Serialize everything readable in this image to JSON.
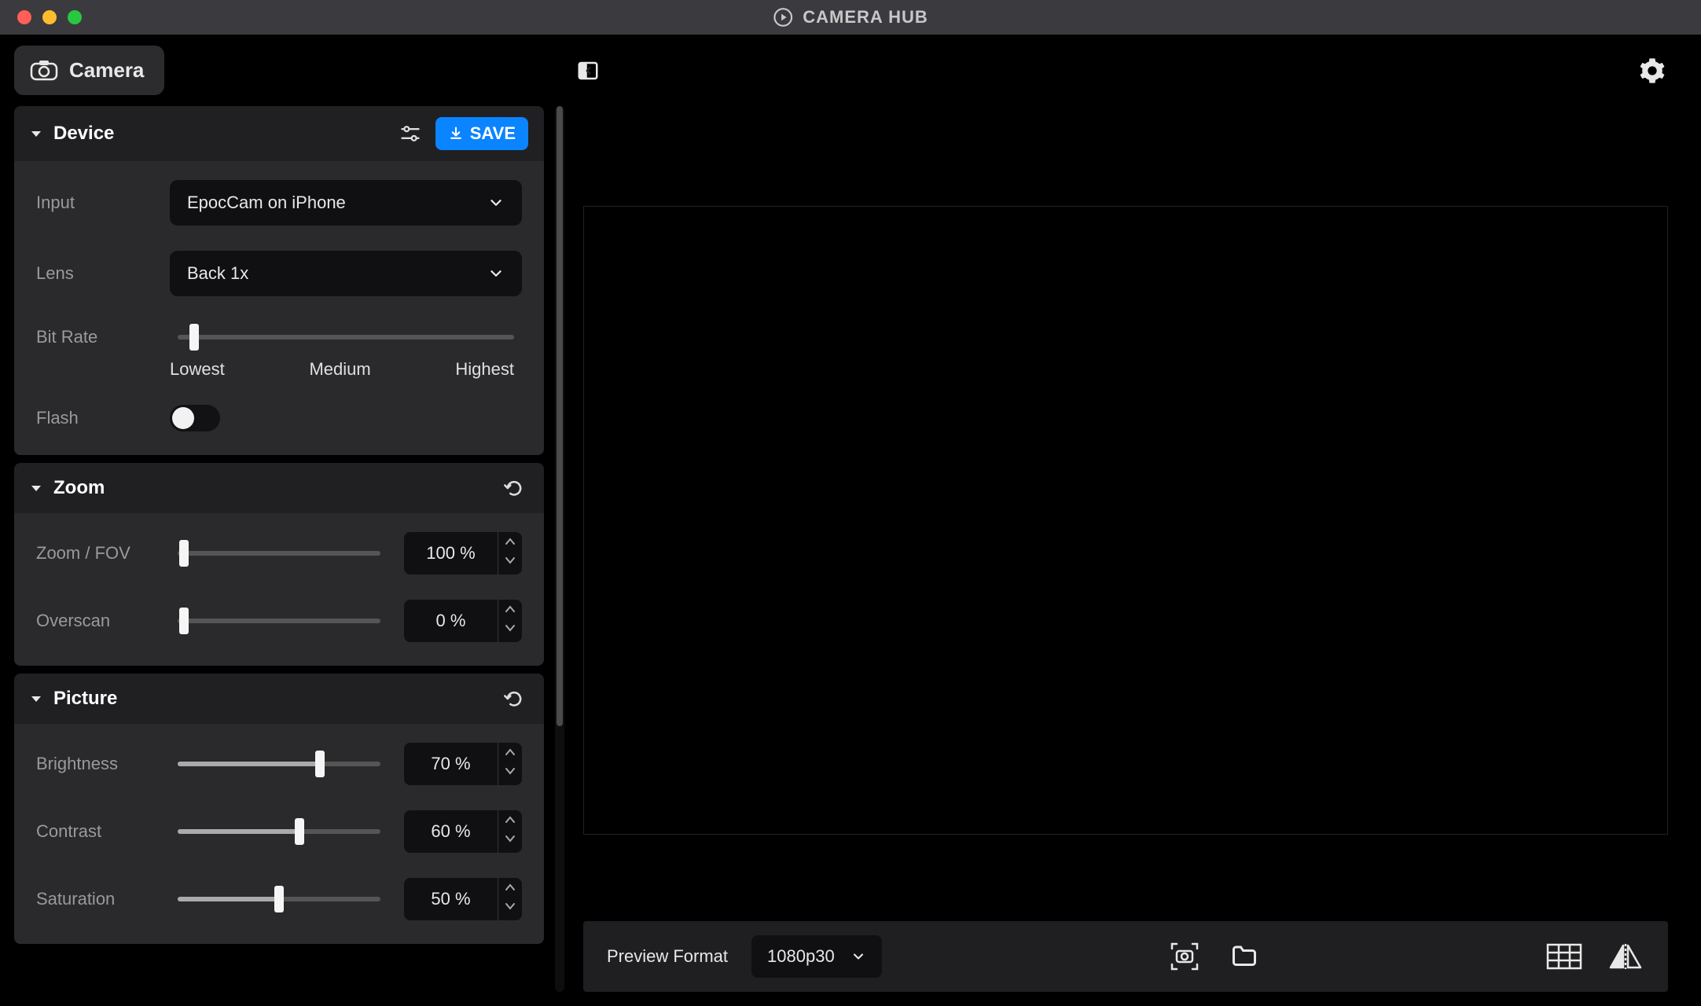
{
  "app": {
    "title": "CAMERA HUB"
  },
  "sidebar": {
    "camera_tab": "Camera",
    "device": {
      "title": "Device",
      "save_label": "SAVE",
      "input_label": "Input",
      "input_value": "EpocCam on iPhone",
      "lens_label": "Lens",
      "lens_value": "Back 1x",
      "bitrate_label": "Bit Rate",
      "bitrate_low": "Lowest",
      "bitrate_med": "Medium",
      "bitrate_high": "Highest",
      "flash_label": "Flash"
    },
    "zoom": {
      "title": "Zoom",
      "fov_label": "Zoom / FOV",
      "fov_value": "100 %",
      "overscan_label": "Overscan",
      "overscan_value": "0 %"
    },
    "picture": {
      "title": "Picture",
      "brightness_label": "Brightness",
      "brightness_value": "70 %",
      "contrast_label": "Contrast",
      "contrast_value": "60 %",
      "saturation_label": "Saturation",
      "saturation_value": "50 %"
    }
  },
  "bottom": {
    "preview_format_label": "Preview Format",
    "preview_format_value": "1080p30"
  }
}
